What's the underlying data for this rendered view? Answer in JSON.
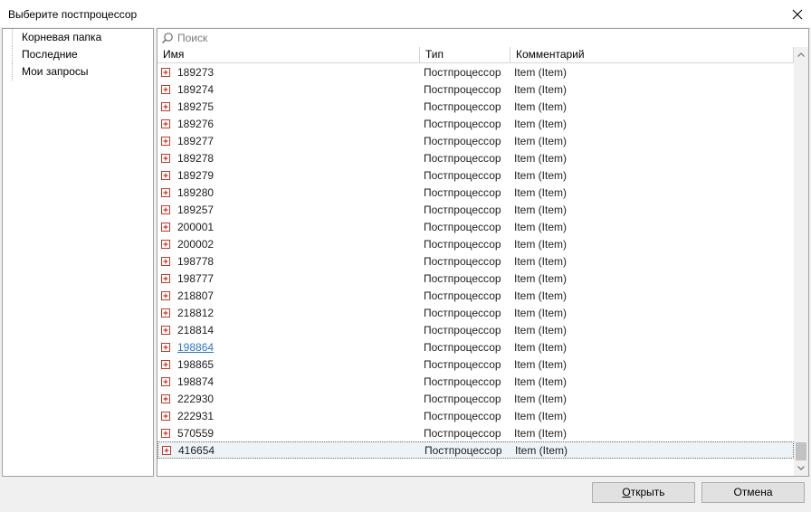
{
  "window": {
    "title": "Выберите постпроцессор"
  },
  "tree": {
    "items": [
      {
        "label": "Корневая папка"
      },
      {
        "label": "Последние"
      },
      {
        "label": "Мои запросы"
      }
    ]
  },
  "search": {
    "placeholder": "Поиск"
  },
  "table": {
    "columns": {
      "name": "Имя",
      "type": "Тип",
      "comment": "Комментарий"
    },
    "rows": [
      {
        "name": "189273",
        "type": "Постпроцессор",
        "comment": "Item (Item)"
      },
      {
        "name": "189274",
        "type": "Постпроцессор",
        "comment": "Item (Item)"
      },
      {
        "name": "189275",
        "type": "Постпроцессор",
        "comment": "Item (Item)"
      },
      {
        "name": "189276",
        "type": "Постпроцессор",
        "comment": "Item (Item)"
      },
      {
        "name": "189277",
        "type": "Постпроцессор",
        "comment": "Item (Item)"
      },
      {
        "name": "189278",
        "type": "Постпроцессор",
        "comment": "Item (Item)"
      },
      {
        "name": "189279",
        "type": "Постпроцессор",
        "comment": "Item (Item)"
      },
      {
        "name": "189280",
        "type": "Постпроцессор",
        "comment": "Item (Item)"
      },
      {
        "name": "189257",
        "type": "Постпроцессор",
        "comment": "Item (Item)"
      },
      {
        "name": "200001",
        "type": "Постпроцессор",
        "comment": "Item (Item)"
      },
      {
        "name": "200002",
        "type": "Постпроцессор",
        "comment": "Item (Item)"
      },
      {
        "name": "198778",
        "type": "Постпроцессор",
        "comment": "Item (Item)"
      },
      {
        "name": "198777",
        "type": "Постпроцессор",
        "comment": "Item (Item)"
      },
      {
        "name": "218807",
        "type": "Постпроцессор",
        "comment": "Item (Item)"
      },
      {
        "name": "218812",
        "type": "Постпроцессор",
        "comment": "Item (Item)"
      },
      {
        "name": "218814",
        "type": "Постпроцессор",
        "comment": "Item (Item)"
      },
      {
        "name": "198864",
        "type": "Постпроцессор",
        "comment": "Item (Item)",
        "hovered": true
      },
      {
        "name": "198865",
        "type": "Постпроцессор",
        "comment": "Item (Item)"
      },
      {
        "name": "198874",
        "type": "Постпроцессор",
        "comment": "Item (Item)"
      },
      {
        "name": "222930",
        "type": "Постпроцессор",
        "comment": "Item (Item)"
      },
      {
        "name": "222931",
        "type": "Постпроцессор",
        "comment": "Item (Item)"
      },
      {
        "name": "570559",
        "type": "Постпроцессор",
        "comment": "Item (Item)"
      },
      {
        "name": "416654",
        "type": "Постпроцессор",
        "comment": "Item (Item)",
        "selected": true
      }
    ]
  },
  "buttons": {
    "open": {
      "mnemonic": "О",
      "rest": "ткрыть"
    },
    "cancel": {
      "mnemonic": "",
      "rest": "Отмена"
    }
  },
  "colors": {
    "link": "#2f74c2",
    "selection": "#eef3f8",
    "expander": "#c0392b"
  }
}
